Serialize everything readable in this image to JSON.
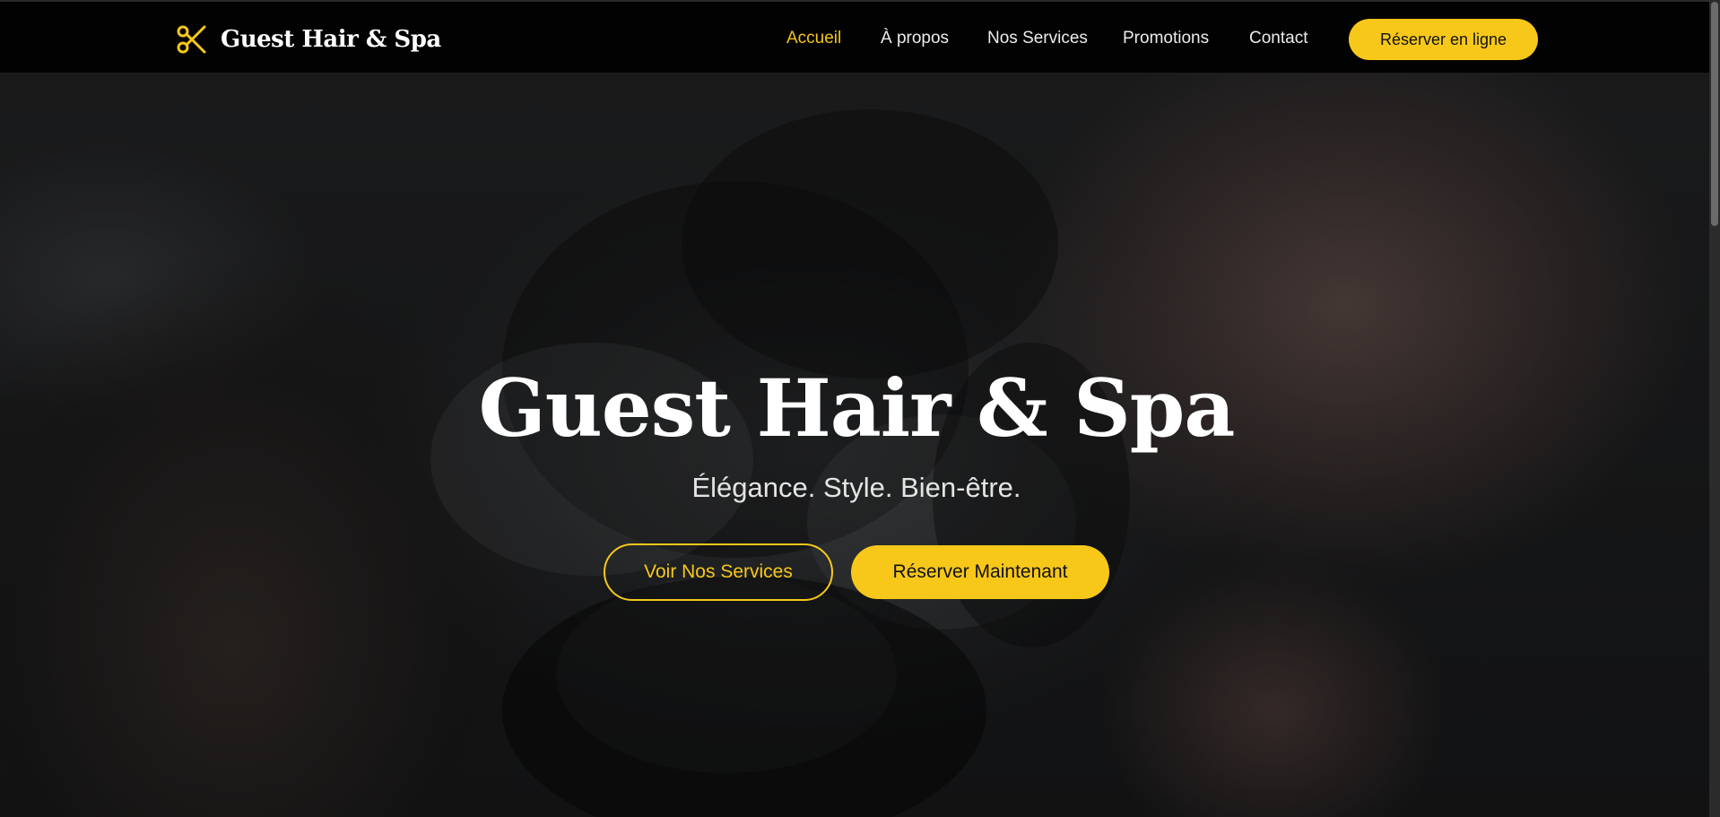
{
  "header": {
    "brand_name": "Guest Hair & Spa",
    "brand_icon": "scissors-icon",
    "nav": [
      {
        "label": "Accueil",
        "active": true
      },
      {
        "label": "À propos",
        "active": false
      },
      {
        "label": "Nos Services",
        "active": false
      },
      {
        "label": "Promotions",
        "active": false
      },
      {
        "label": "Contact",
        "active": false
      }
    ],
    "cta_label": "Réserver en ligne"
  },
  "hero": {
    "title": "Guest Hair & Spa",
    "subtitle": "Élégance. Style. Bien-être.",
    "primary_button": "Voir Nos Services",
    "secondary_button": "Réserver Maintenant"
  },
  "colors": {
    "accent": "#f7c81a",
    "header_bg": "#020202",
    "text": "#ffffff"
  }
}
